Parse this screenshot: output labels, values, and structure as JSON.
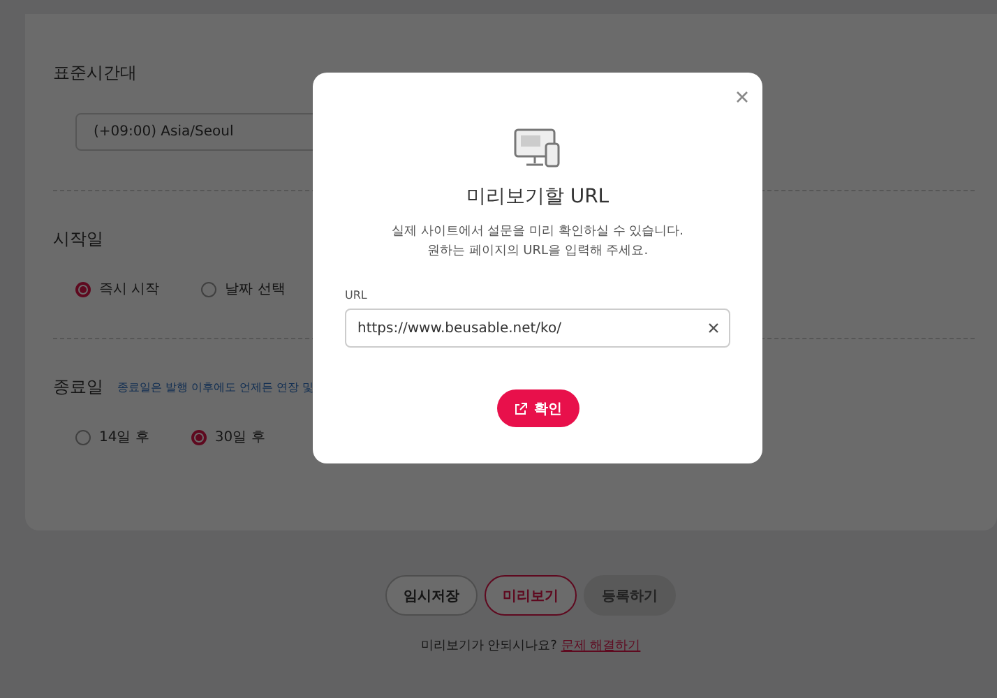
{
  "settings": {
    "timezone": {
      "label": "표준시간대",
      "value": "(+09:00) Asia/Seoul"
    },
    "start_date": {
      "label": "시작일",
      "options": [
        {
          "label": "즉시 시작",
          "selected": true
        },
        {
          "label": "날짜 선택",
          "selected": false
        }
      ]
    },
    "end_date": {
      "label": "종료일",
      "hint": "종료일은 발행 이후에도 언제든 연장 및",
      "options": [
        {
          "label": "14일 후",
          "selected": false
        },
        {
          "label": "30일 후",
          "selected": true
        }
      ]
    }
  },
  "actions": [
    {
      "label": "임시저장",
      "kind": "outline",
      "disabled": false
    },
    {
      "label": "미리보기",
      "kind": "primary-outline",
      "disabled": false
    },
    {
      "label": "등록하기",
      "kind": "filled",
      "disabled": true
    }
  ],
  "help": {
    "text": "미리보기가 안되시나요?",
    "link": "문제 해결하기"
  },
  "dialog": {
    "title": "미리보기할 URL",
    "description": [
      "실제 사이트에서 설문을 미리 확인하실 수 있습니다.",
      "원하는 페이지의 URL을 입력해 주세요."
    ],
    "field_label": "URL",
    "value": "https://www.beusable.net/ko/",
    "confirm": "확인"
  }
}
